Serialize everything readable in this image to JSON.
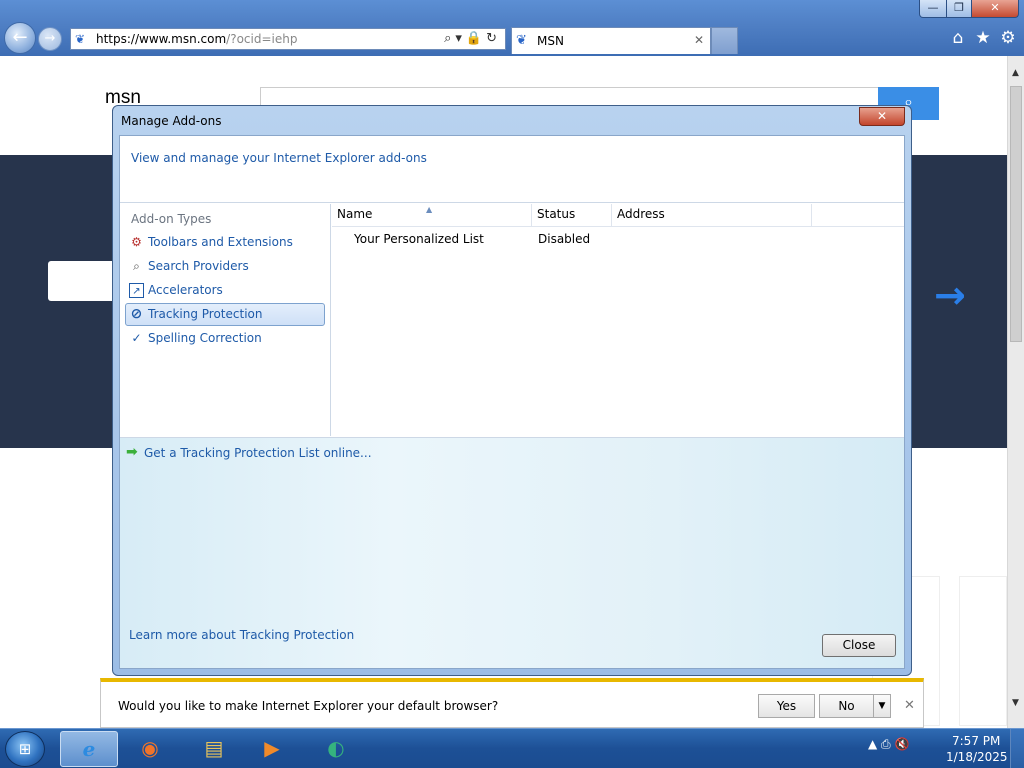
{
  "window": {
    "minimize_glyph": "—",
    "maximize_glyph": "❐",
    "close_glyph": "✕"
  },
  "nav": {
    "back_glyph": "←",
    "forward_glyph": "→"
  },
  "address_bar": {
    "url_host": "https://www.msn.com",
    "url_rest": "/?ocid=iehp",
    "tools_glyphs": "⌕▾🔒↻"
  },
  "tab": {
    "label": "MSN",
    "close_glyph": "✕"
  },
  "command_bar": {
    "home_glyph": "⌂",
    "favorites_glyph": "★",
    "tools_glyph": "⚙"
  },
  "page": {
    "logo_text": "msn",
    "search_glyph": "⌕",
    "arrow_glyph": "→"
  },
  "dialog": {
    "title": "Manage Add-ons",
    "close_glyph": "✕",
    "header_text": "View and manage your Internet Explorer add-ons",
    "addon_types_title": "Add-on Types",
    "addon_types": [
      {
        "label": "Toolbars and Extensions",
        "icon": "gear-icon",
        "glyph": "⚙"
      },
      {
        "label": "Search Providers",
        "icon": "search-icon",
        "glyph": "⌕"
      },
      {
        "label": "Accelerators",
        "icon": "accelerator-icon",
        "glyph": "↗"
      },
      {
        "label": "Tracking Protection",
        "icon": "tracking-protection-icon",
        "glyph": "⊘"
      },
      {
        "label": "Spelling Correction",
        "icon": "spelling-check-icon",
        "glyph": "✓"
      }
    ],
    "selected_type": "Tracking Protection",
    "columns": [
      "Name",
      "Status",
      "Address"
    ],
    "rows": [
      {
        "name": "Your Personalized List",
        "status": "Disabled",
        "address": ""
      }
    ],
    "get_online_link": "Get a Tracking Protection List online...",
    "learn_more_link": "Learn more about Tracking Protection",
    "close_button": "Close"
  },
  "notification": {
    "message": "Would you like to make Internet Explorer your default browser?",
    "yes": "Yes",
    "no": "No",
    "dropdown_glyph": "▼",
    "close_glyph": "✕"
  },
  "taskbar": {
    "start_glyph": "⊞",
    "apps": [
      {
        "name": "internet-explorer",
        "glyph": "e",
        "active": true
      },
      {
        "name": "firefox",
        "glyph": "◉",
        "active": false
      },
      {
        "name": "file-explorer",
        "glyph": "▤",
        "active": false
      },
      {
        "name": "media-player",
        "glyph": "▶",
        "active": false
      },
      {
        "name": "app",
        "glyph": "◐",
        "active": false
      }
    ],
    "tray_glyphs": "▲ ⎙ 🔇",
    "time": "7:57 PM",
    "date": "1/18/2025"
  },
  "colors": {
    "chrome_blue": "#4f7fc4",
    "banner_navy": "#27344c",
    "link_blue": "#1e5aa8",
    "notify_accent": "#e8b800"
  }
}
